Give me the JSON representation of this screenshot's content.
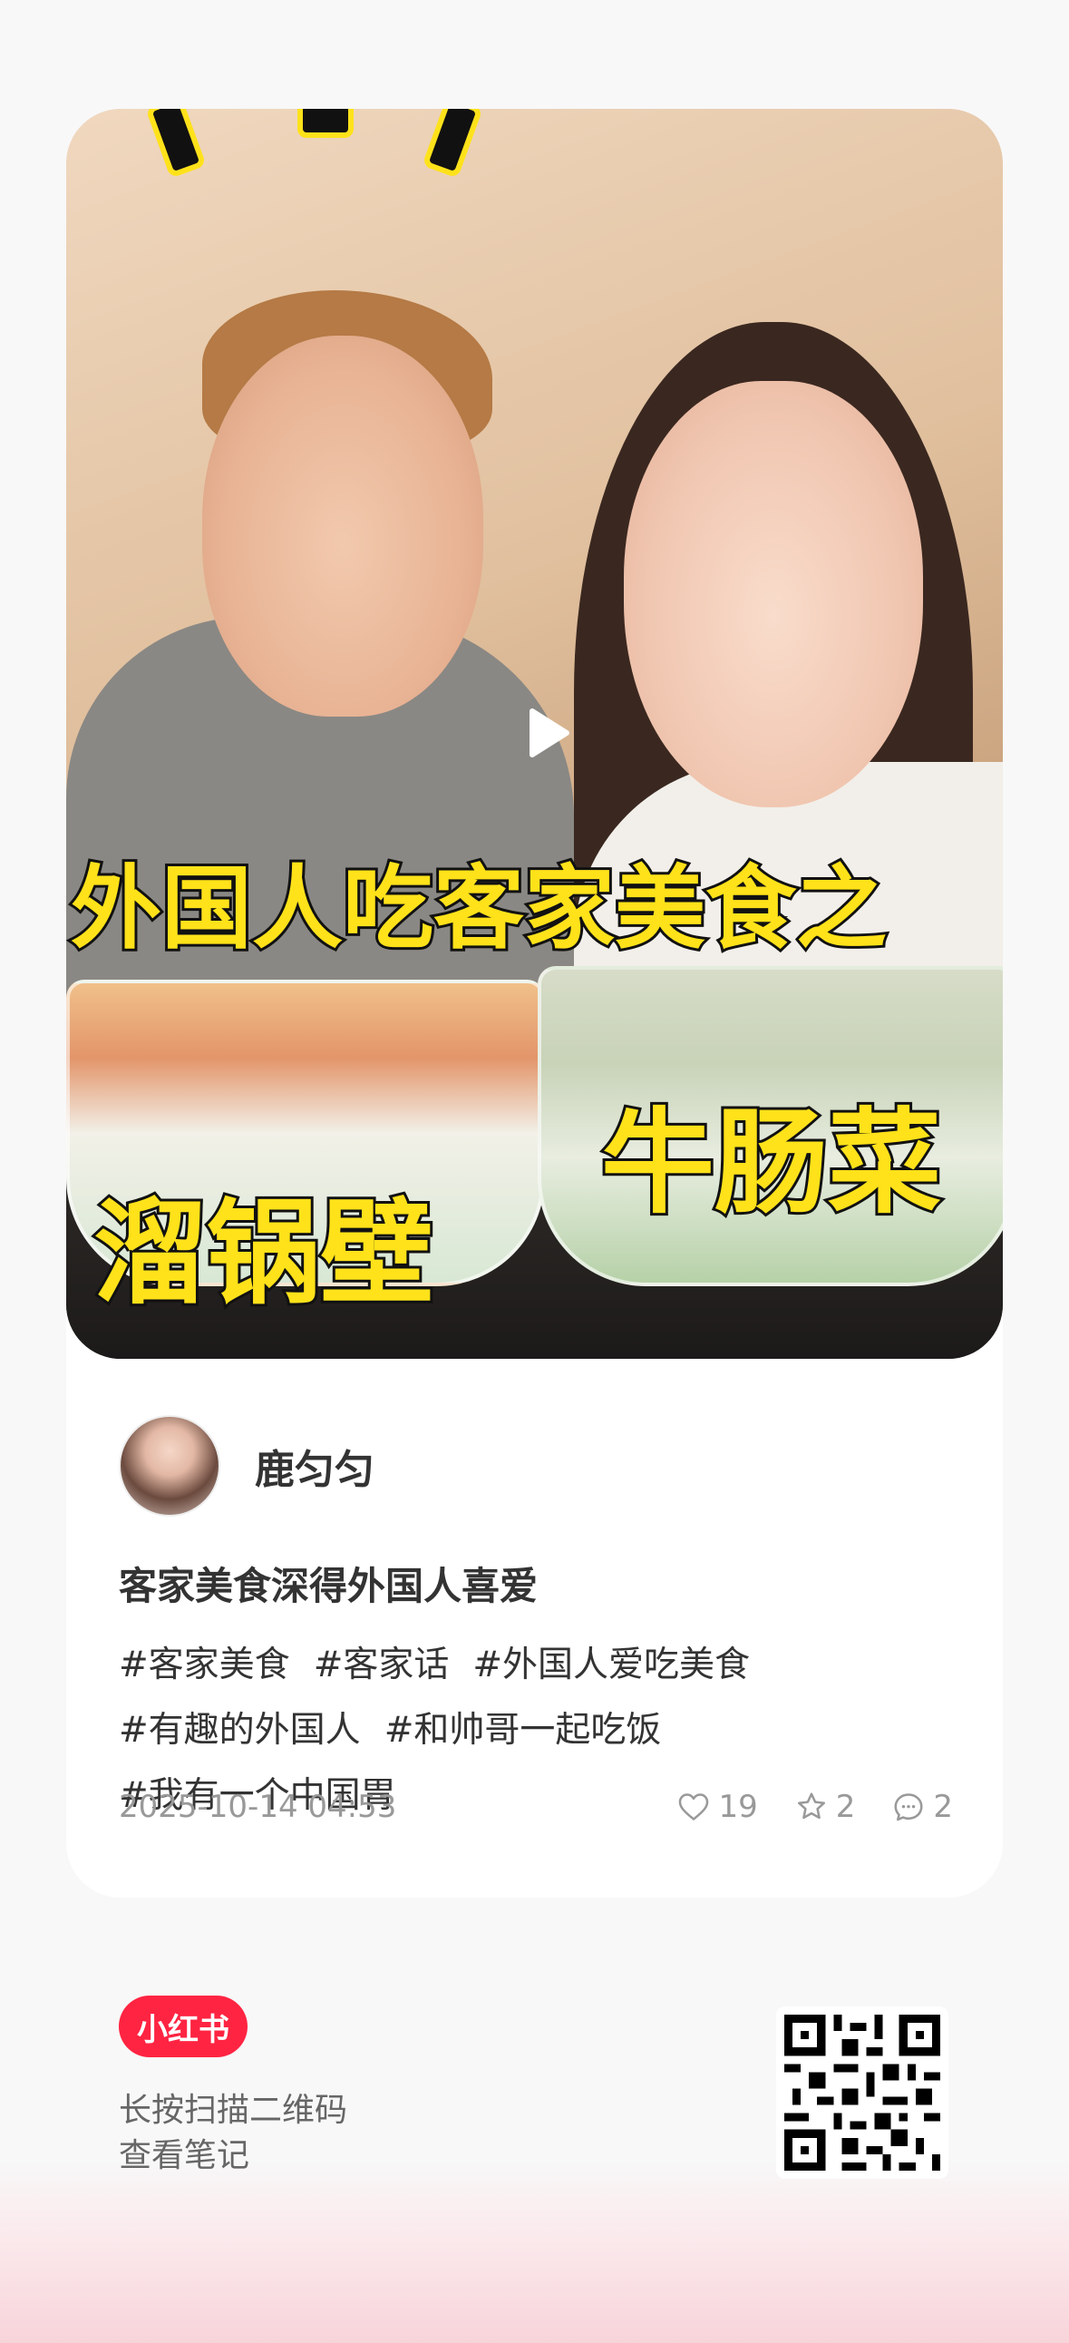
{
  "post": {
    "overlay_title": "外国人吃客家美食之",
    "overlay_dish_left": "溜锅壁",
    "overlay_dish_right": "牛肠菜",
    "author_name": "鹿匀匀",
    "title": "客家美食深得外国人喜爱",
    "tags": [
      "#客家美食",
      "#客家话",
      "#外国人爱吃美食",
      "#有趣的外国人",
      "#和帅哥一起吃饭",
      "#我有一个中国胃"
    ],
    "timestamp": "2025-10-14 04:53",
    "likes": "19",
    "collects": "2",
    "comments": "2"
  },
  "footer": {
    "brand": "小红书",
    "hint_line1": "长按扫描二维码",
    "hint_line2": "查看笔记"
  },
  "icons": {
    "play": "play-icon",
    "like": "heart-icon",
    "collect": "star-icon",
    "comment": "comment-icon"
  },
  "colors": {
    "brand_red": "#ff2442",
    "overlay_yellow": "#ffe21a",
    "text_primary": "#333333",
    "text_secondary": "#999999"
  }
}
